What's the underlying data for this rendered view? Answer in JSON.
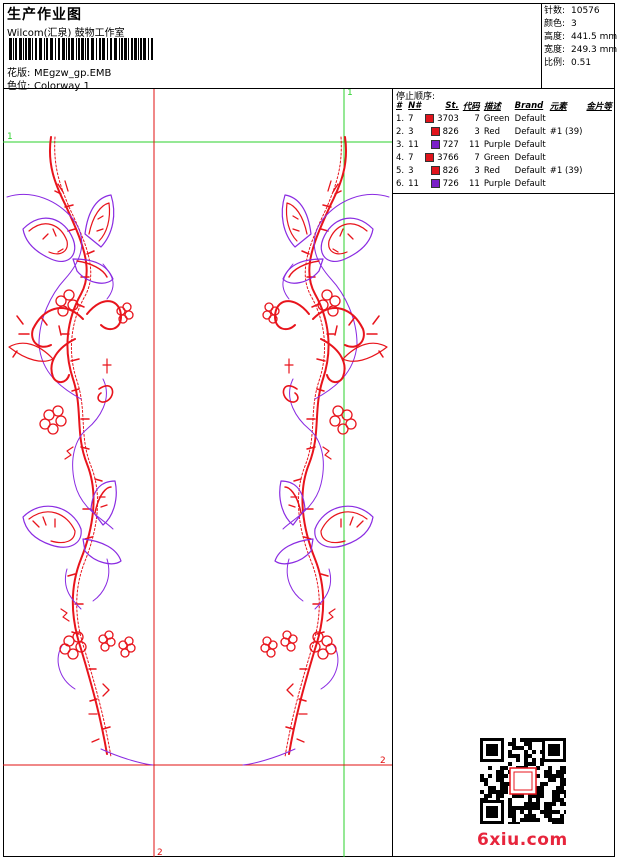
{
  "header": {
    "title": "生产作业图",
    "company": "Wilcom(汇泉) 鼓物工作室",
    "design_label": "花版:",
    "design_file": "MEgzw_gp.EMB",
    "colorway_label": "色位:",
    "colorway": "Colorway 1"
  },
  "stats": [
    {
      "label": "针数:",
      "value": "10576"
    },
    {
      "label": "颜色:",
      "value": "3"
    },
    {
      "label": "高度:",
      "value": "441.5 mm"
    },
    {
      "label": "宽度:",
      "value": "249.3 mm"
    },
    {
      "label": "比例:",
      "value": "0.51"
    }
  ],
  "markers": {
    "a": "1",
    "b": "1",
    "c": "2",
    "d": "2"
  },
  "stop_sequence": {
    "title": "停止顺序:",
    "columns": [
      "#",
      "N#",
      "St.",
      "代码",
      "描述",
      "Brand",
      "元素",
      "金片等"
    ],
    "rows": [
      {
        "idx": "1.",
        "n": "7",
        "color": "#e0141c",
        "st": "3703",
        "code": "7",
        "desc": "Green",
        "brand": "Default",
        "elem": "",
        "seq": ""
      },
      {
        "idx": "2.",
        "n": "3",
        "color": "#e0141c",
        "st": "826",
        "code": "3",
        "desc": "Red",
        "brand": "Default",
        "elem": "#1 (39)",
        "seq": ""
      },
      {
        "idx": "3.",
        "n": "11",
        "color": "#7a1ec8",
        "st": "727",
        "code": "11",
        "desc": "Purple",
        "brand": "Default",
        "elem": "",
        "seq": ""
      },
      {
        "idx": "4.",
        "n": "7",
        "color": "#e0141c",
        "st": "3766",
        "code": "7",
        "desc": "Green",
        "brand": "Default",
        "elem": "",
        "seq": ""
      },
      {
        "idx": "5.",
        "n": "3",
        "color": "#e0141c",
        "st": "826",
        "code": "3",
        "desc": "Red",
        "brand": "Default",
        "elem": "#1 (39)",
        "seq": ""
      },
      {
        "idx": "6.",
        "n": "11",
        "color": "#7a1ec8",
        "st": "726",
        "code": "11",
        "desc": "Purple",
        "brand": "Default",
        "elem": "",
        "seq": ""
      }
    ]
  },
  "watermark": {
    "site": "6xiu.com"
  },
  "colors": {
    "thread_red": "#e8141c",
    "thread_purple": "#8a2be2",
    "guide_green": "#2bd12b",
    "guide_red": "#e01010"
  }
}
